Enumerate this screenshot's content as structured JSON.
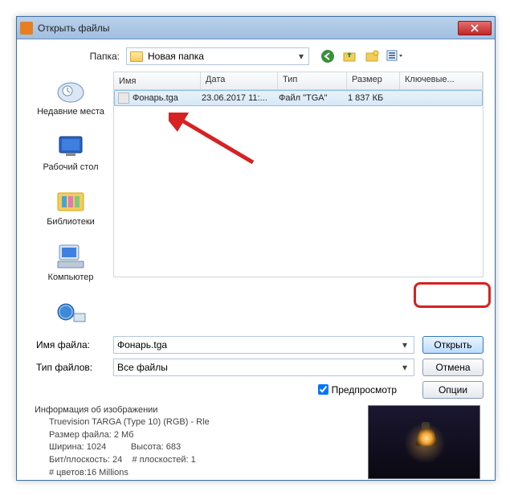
{
  "title": "Открыть файлы",
  "folder_label": "Папка:",
  "folder_name": "Новая папка",
  "places": {
    "recent": "Недавние места",
    "desktop": "Рабочий стол",
    "libraries": "Библиотеки",
    "computer": "Компьютер"
  },
  "columns": {
    "name": "Имя",
    "date": "Дата",
    "type": "Тип",
    "size": "Размер",
    "keywords": "Ключевые..."
  },
  "file": {
    "name": "Фонарь.tga",
    "date": "23.06.2017 11:...",
    "type": "Файл \"TGA\"",
    "size": "1 837 КБ"
  },
  "filename_label": "Имя файла:",
  "filename_value": "Фонарь.tga",
  "filetype_label": "Тип файлов:",
  "filetype_value": "Все файлы",
  "buttons": {
    "open": "Открыть",
    "cancel": "Отмена",
    "options": "Опции"
  },
  "preview_label": "Предпросмотр",
  "info_title": "Информация об изображении",
  "info_lines": {
    "format": "Truevision TARGA (Type 10) (RGB) - Rle",
    "filesize": "Размер файла: 2 Мб",
    "width": "Ширина: 1024",
    "height": "Высота: 683",
    "bits": "Бит/плоскость: 24",
    "planes": "# плоскостей: 1",
    "colors": "# цветов:16 Millions"
  }
}
